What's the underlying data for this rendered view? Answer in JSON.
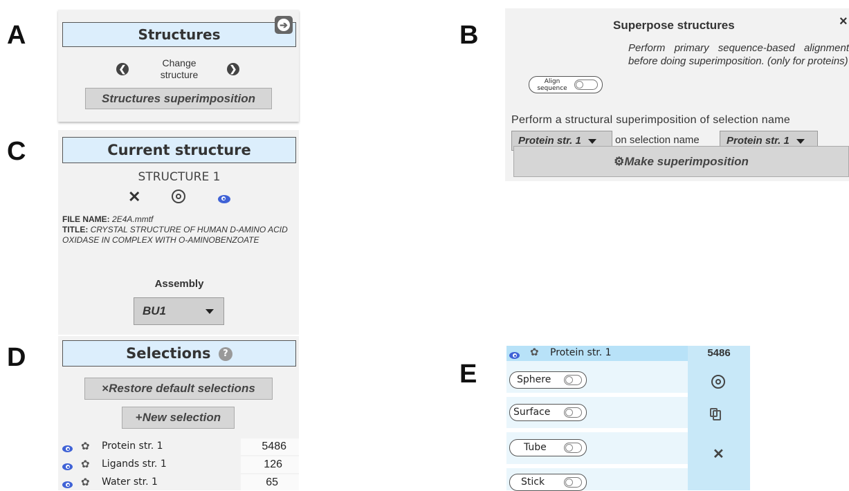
{
  "labels": {
    "a": "A",
    "b": "B",
    "c": "C",
    "d": "D",
    "e": "E"
  },
  "panel_a": {
    "title": "Structures",
    "change_line1": "Change",
    "change_line2": "structure",
    "superimpose_button": "Structures superimposition"
  },
  "panel_b": {
    "title": "Superpose structures",
    "close": "×",
    "align_line1": "Align",
    "align_line2": "sequence",
    "description": "Perform primary sequence-based alignment before doing superimposition. (only for proteins)",
    "perform_text": "Perform a structural superimposition of selection name",
    "select1_value": "Protein str. 1",
    "on_text": "on selection name",
    "select2_value": "Protein str. 1",
    "make_button": "Make superimposition"
  },
  "panel_c": {
    "title": "Current structure",
    "structure_name": "STRUCTURE 1",
    "file_name_label": "FILE NAME:",
    "file_name_value": "2E4A.mmtf",
    "title_label": "TITLE:",
    "title_value": "CRYSTAL STRUCTURE OF HUMAN D-AMINO ACID OXIDASE IN COMPLEX WITH O-AMINOBENZOATE",
    "assembly_label": "Assembly",
    "assembly_value": "BU1"
  },
  "panel_d": {
    "title": "Selections",
    "help": "?",
    "restore_button": "Restore default selections",
    "new_button": "New selection",
    "rows": [
      {
        "name": "Protein str. 1",
        "count": "5486"
      },
      {
        "name": "Ligands str. 1",
        "count": "126"
      },
      {
        "name": "Water str. 1",
        "count": "65"
      }
    ]
  },
  "panel_e": {
    "selection_name": "Protein str. 1",
    "count": "5486",
    "toggles": [
      "Sphere",
      "Surface",
      "Tube",
      "Stick"
    ]
  },
  "colors": {
    "header_bg": "#dceefc",
    "eye": "#3f62d6",
    "panel_e_bg": "#c8e8f8"
  }
}
